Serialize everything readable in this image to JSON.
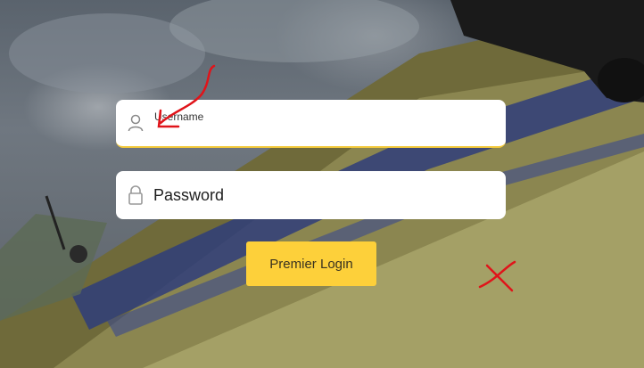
{
  "username": {
    "label": "Username",
    "value": "",
    "icon": "user-icon"
  },
  "password": {
    "placeholder": "Password",
    "value": "",
    "icon": "lock-icon"
  },
  "login_button": {
    "label": "Premier Login",
    "color": "#fdd03a"
  },
  "colors": {
    "field_background": "#ffffff",
    "focus_underline": "#f3c93b",
    "annotation": "#e0141a"
  }
}
